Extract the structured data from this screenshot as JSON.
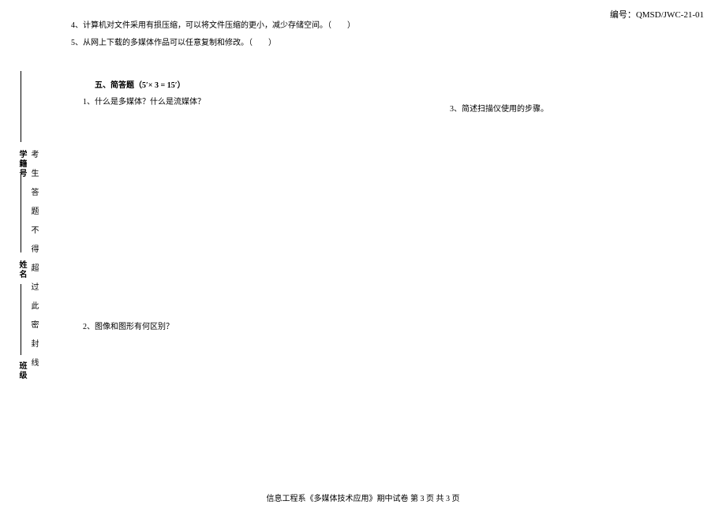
{
  "header": {
    "code": "编号：QMSD/JWC-21-01"
  },
  "binding": {
    "banji": "班级",
    "xingming": "姓名",
    "xuejihao": "学籍号",
    "sealText": "考生答题不得超过此密封线"
  },
  "questions": {
    "q4": "4、计算机对文件采用有损压缩，可以将文件压缩的更小，减少存储空间。（　　）",
    "q5": "5、从网上下载的多媒体作品可以任意复制和修改。（　　）"
  },
  "section5": {
    "title": "五、简答题（5′× 3 = 15′）",
    "q1": "1、什么是多媒体？什么是流媒体？",
    "q2": "2、图像和图形有何区别？",
    "q3": "3、简述扫描仪使用的步骤。"
  },
  "footer": {
    "text": "信息工程系《多媒体技术应用》期中试卷 第 3 页 共 3 页"
  }
}
